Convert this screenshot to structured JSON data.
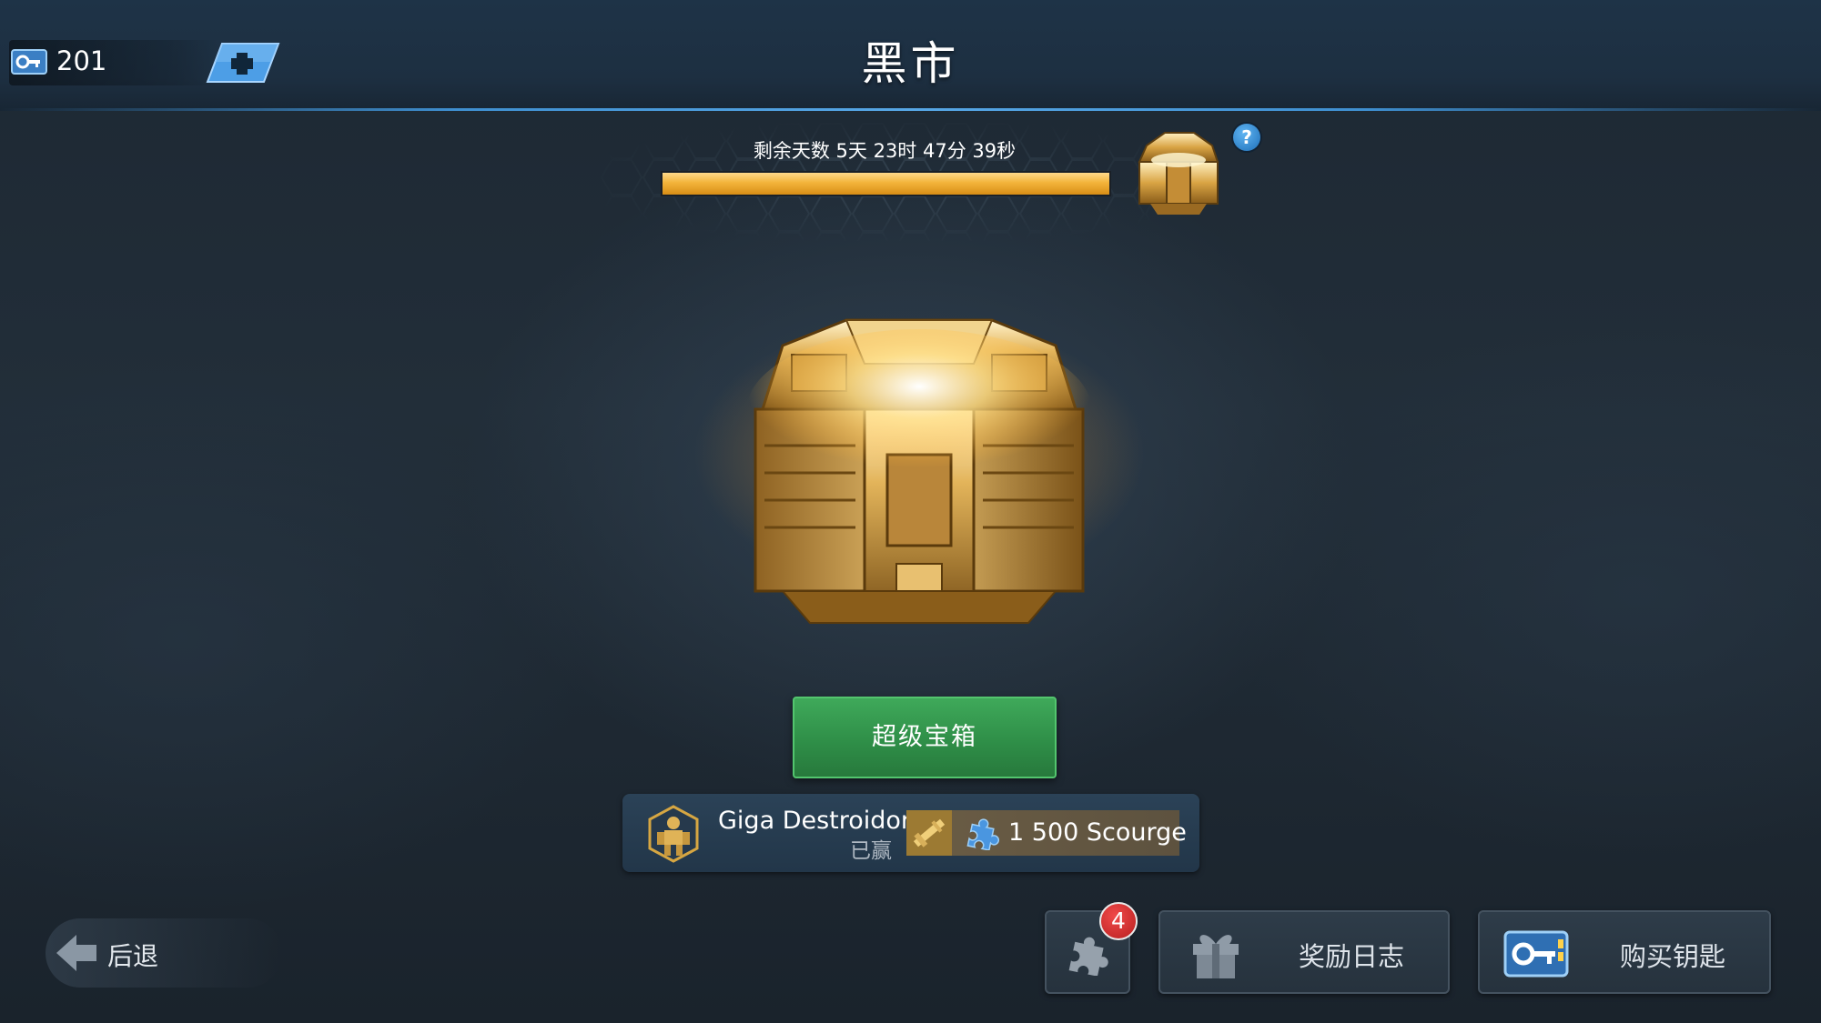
{
  "header": {
    "title": "黑市",
    "keys_count": "201",
    "key_icon": "key-card-icon",
    "add_icon": "plus-icon"
  },
  "timer": {
    "text": "剩余天数 5天 23时 47分 39秒",
    "progress_percent": 100,
    "help_label": "?"
  },
  "chest": {
    "open_button_label": "超级宝箱"
  },
  "last_winner": {
    "name": "Giga Destroidor",
    "status": "已赢",
    "reward_label": "1 500 Scourge",
    "reward_icons": [
      "weapon-icon",
      "puzzle-piece-icon"
    ]
  },
  "footer": {
    "back_label": "后退",
    "fragments_badge": "4",
    "rewards_log_label": "奖励日志",
    "buy_keys_label": "购买钥匙"
  },
  "colors": {
    "accent_blue": "#3f8fd0",
    "progress_gold": "#f3b43b",
    "button_green": "#2f8f48",
    "badge_red": "#d32a2a"
  }
}
